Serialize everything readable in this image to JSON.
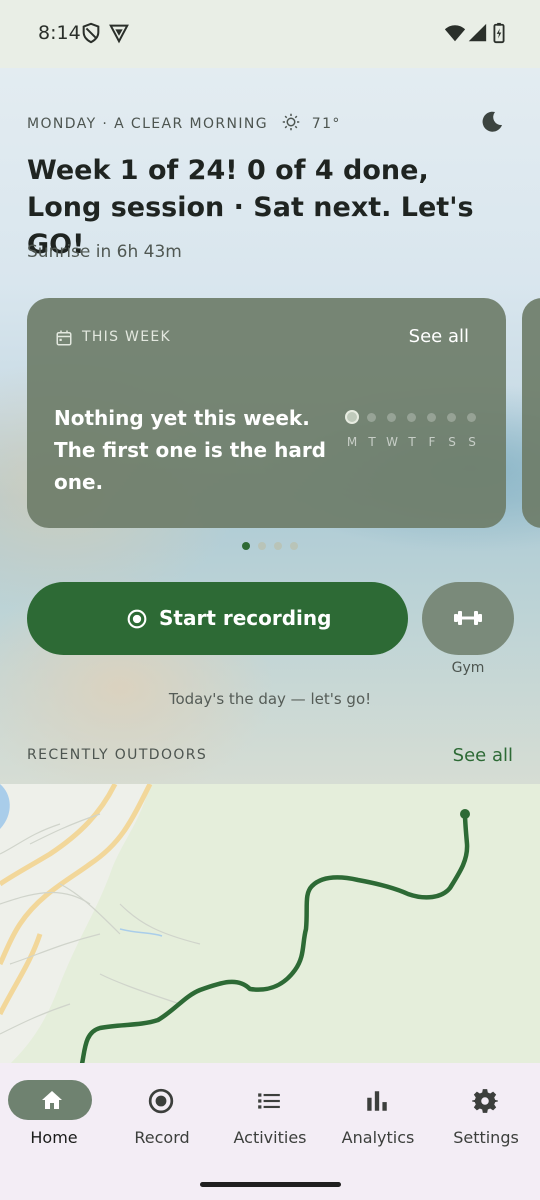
{
  "status_bar": {
    "time": "8:14",
    "icons": [
      "shield-icon",
      "vpn-shield-icon",
      "wifi-icon",
      "cell-signal-icon",
      "battery-icon"
    ]
  },
  "header": {
    "date_line": "MONDAY · A CLEAR MORNING",
    "weather_icon": "sun-icon",
    "temperature": "71°",
    "theme_icon": "moon-icon",
    "headline": "Week 1 of 24! 0 of 4 done, Long session · Sat next. Let's GO!",
    "sunrise": "Sunrise in 6h 43m"
  },
  "week_card": {
    "title": "THIS WEEK",
    "see_all": "See all",
    "message": "Nothing yet this week. The first one is the hard one.",
    "days": [
      "M",
      "T",
      "W",
      "T",
      "F",
      "S",
      "S"
    ],
    "today_index": 0,
    "pager_count": 4,
    "pager_active": 0
  },
  "actions": {
    "start_label": "Start recording",
    "gym_label": "Gym",
    "motivation": "Today's the day — let's go!"
  },
  "recent": {
    "title": "RECENTLY OUTDOORS",
    "see_all": "See all"
  },
  "nav": {
    "items": [
      {
        "label": "Home",
        "icon": "home-icon",
        "active": true
      },
      {
        "label": "Record",
        "icon": "record-icon",
        "active": false
      },
      {
        "label": "Activities",
        "icon": "list-icon",
        "active": false
      },
      {
        "label": "Analytics",
        "icon": "bar-chart-icon",
        "active": false
      },
      {
        "label": "Settings",
        "icon": "gear-icon",
        "active": false
      }
    ]
  },
  "colors": {
    "accent": "#2d6a35",
    "card": "#6e7d69",
    "nav_bg": "#f3edf5",
    "map_route": "#2d6a35"
  }
}
